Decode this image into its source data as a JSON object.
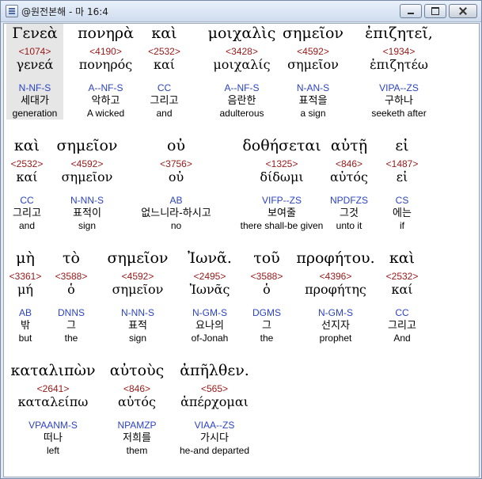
{
  "window": {
    "title": "@원전본해 - 마 16:4"
  },
  "rows": [
    [
      {
        "greek": "Γενεὰ",
        "number": "<1074>",
        "lemma": "γενεά",
        "morph": "N-NF-S",
        "korean": "세대가",
        "english": "generation"
      },
      {
        "greek": "πονηρὰ",
        "number": "<4190>",
        "lemma": "πονηρός",
        "morph": "A--NF-S",
        "korean": "악하고",
        "english": "A wicked"
      },
      {
        "greek": "καὶ",
        "number": "<2532>",
        "lemma": "καί",
        "morph": "CC",
        "korean": "그리고",
        "english": "and"
      },
      {
        "greek": "μοιχαλὶς",
        "number": "<3428>",
        "lemma": "μοιχαλίς",
        "morph": "A--NF-S",
        "korean": "음란한",
        "english": "adulterous"
      },
      {
        "greek": "σημεῖον",
        "number": "<4592>",
        "lemma": "σημεῖον",
        "morph": "N-AN-S",
        "korean": "표적을",
        "english": "a sign"
      },
      {
        "greek": "ἐπιζητεῖ,",
        "number": "<1934>",
        "lemma": "ἐπιζητέω",
        "morph": "VIPA--ZS",
        "korean": "구하나",
        "english": "seeketh after"
      }
    ],
    [
      {
        "greek": "καὶ",
        "number": "<2532>",
        "lemma": "καί",
        "morph": "CC",
        "korean": "그리고",
        "english": "and"
      },
      {
        "greek": "σημεῖον",
        "number": "<4592>",
        "lemma": "σημεῖον",
        "morph": "N-NN-S",
        "korean": "표적이",
        "english": "sign"
      },
      {
        "greek": "οὐ",
        "number": "<3756>",
        "lemma": "οὐ",
        "morph": "AB",
        "korean": "없느니라-하시고",
        "english": "no"
      },
      {
        "greek": "δοθήσεται",
        "number": "<1325>",
        "lemma": "δίδωμι",
        "morph": "VIFP--ZS",
        "korean": "보여줄",
        "english": "there shall-be given"
      },
      {
        "greek": "αὐτῇ",
        "number": "<846>",
        "lemma": "αὐτός",
        "morph": "NPDFZS",
        "korean": "그것",
        "english": "unto it"
      },
      {
        "greek": "εἰ",
        "number": "<1487>",
        "lemma": "εἰ",
        "morph": "CS",
        "korean": "에는",
        "english": "if"
      }
    ],
    [
      {
        "greek": "μὴ",
        "number": "<3361>",
        "lemma": "μή",
        "morph": "AB",
        "korean": "밖",
        "english": "but"
      },
      {
        "greek": "τὸ",
        "number": "<3588>",
        "lemma": "ὁ",
        "morph": "DNNS",
        "korean": "그",
        "english": "the"
      },
      {
        "greek": "σημεῖον",
        "number": "<4592>",
        "lemma": "σημεῖον",
        "morph": "N-NN-S",
        "korean": "표적",
        "english": "sign"
      },
      {
        "greek": "Ἰωνᾶ.",
        "number": "<2495>",
        "lemma": "Ἰωνᾶς",
        "morph": "N-GM-S",
        "korean": "요나의",
        "english": "of-Jonah"
      },
      {
        "greek": "τοῦ",
        "number": "<3588>",
        "lemma": "ὁ",
        "morph": "DGMS",
        "korean": "그",
        "english": "the"
      },
      {
        "greek": "προφήτου.",
        "number": "<4396>",
        "lemma": "προφήτης",
        "morph": "N-GM-S",
        "korean": "선지자",
        "english": "prophet"
      },
      {
        "greek": "καὶ",
        "number": "<2532>",
        "lemma": "καί",
        "morph": "CC",
        "korean": "그리고",
        "english": "And"
      }
    ],
    [
      {
        "greek": "καταλιπὼν",
        "number": "<2641>",
        "lemma": "καταλείπω",
        "morph": "VPAANM-S",
        "korean": "떠나",
        "english": "left"
      },
      {
        "greek": "αὐτοὺς",
        "number": "<846>",
        "lemma": "αὐτός",
        "morph": "NPAMZP",
        "korean": "저희를",
        "english": "them"
      },
      {
        "greek": "ἀπῆλθεν.",
        "number": "<565>",
        "lemma": "ἀπέρχομαι",
        "morph": "VIAA--ZS",
        "korean": "가시다",
        "english": "he-and departed"
      }
    ]
  ]
}
